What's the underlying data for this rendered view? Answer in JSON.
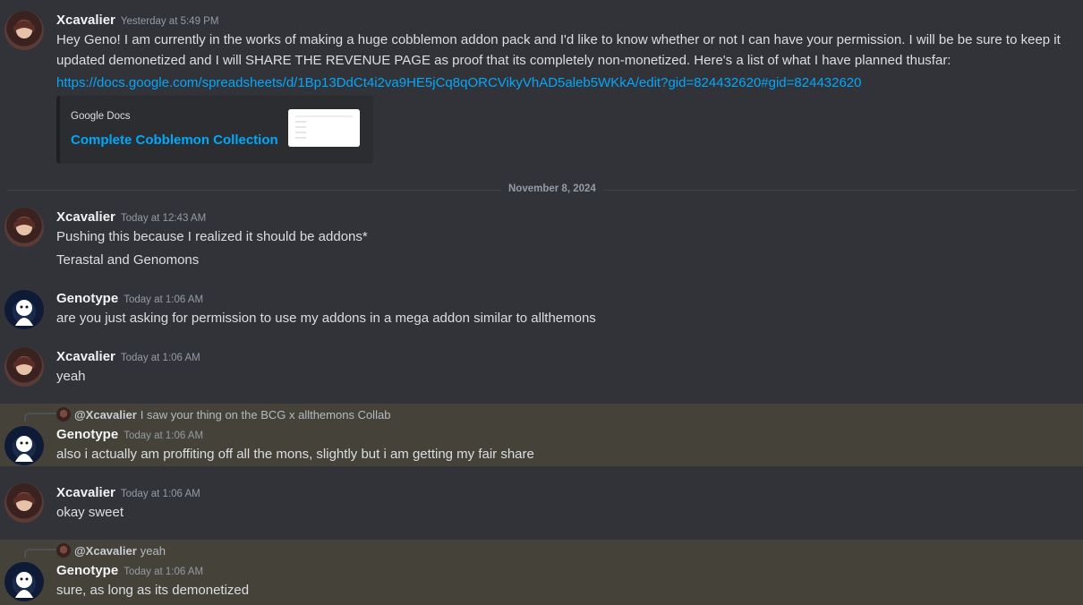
{
  "messages": {
    "m1": {
      "author": "Xcavalier",
      "timestamp": "Yesterday at 5:49 PM",
      "text": "Hey Geno! I am currently in the works of making a huge cobblemon addon pack and I'd like to know whether or not I can have your permission. I will be be sure to keep it updated demonetized and I will SHARE THE REVENUE PAGE as proof that its completely non-monetized. Here's a list of what I have planned thusfar:",
      "link": "https://docs.google.com/spreadsheets/d/1Bp13DdCt4i2va9HE5jCq8qORCVikyVhAD5aleb5WKkA/edit?gid=824432620#gid=824432620",
      "embed": {
        "provider": "Google Docs",
        "title": "Complete Cobblemon Collection"
      }
    },
    "divider": "November 8, 2024",
    "m2": {
      "author": "Xcavalier",
      "timestamp": "Today at 12:43 AM",
      "lines": [
        "Pushing this because I realized it should be addons*",
        "Terastal and Genomons"
      ]
    },
    "m3": {
      "author": "Genotype",
      "timestamp": "Today at 1:06 AM",
      "text": "are you just asking for permission to use my addons in a mega addon similar to allthemons"
    },
    "m4": {
      "author": "Xcavalier",
      "timestamp": "Today at 1:06 AM",
      "text": "yeah"
    },
    "m5": {
      "reply_to": "@Xcavalier",
      "reply_text": "I saw your thing on the BCG x allthemons Collab",
      "author": "Genotype",
      "timestamp": "Today at 1:06 AM",
      "text": "also i actually am proffiting off all the mons, slightly but i am getting my fair share"
    },
    "m6": {
      "author": "Xcavalier",
      "timestamp": "Today at 1:06 AM",
      "text": "okay sweet"
    },
    "m7": {
      "reply_to": "@Xcavalier",
      "reply_text": "yeah",
      "author": "Genotype",
      "timestamp": "Today at 1:06 AM",
      "text": "sure, as long as its demonetized"
    }
  },
  "colors": {
    "background": "#323339",
    "highlight": "#45423a",
    "link": "#00a8fc",
    "username": "#f2f3f5",
    "timestamp": "#949ba4"
  },
  "icons": {
    "xcavalier_avatar": "avatar-image",
    "genotype_avatar": "avatar-image"
  }
}
